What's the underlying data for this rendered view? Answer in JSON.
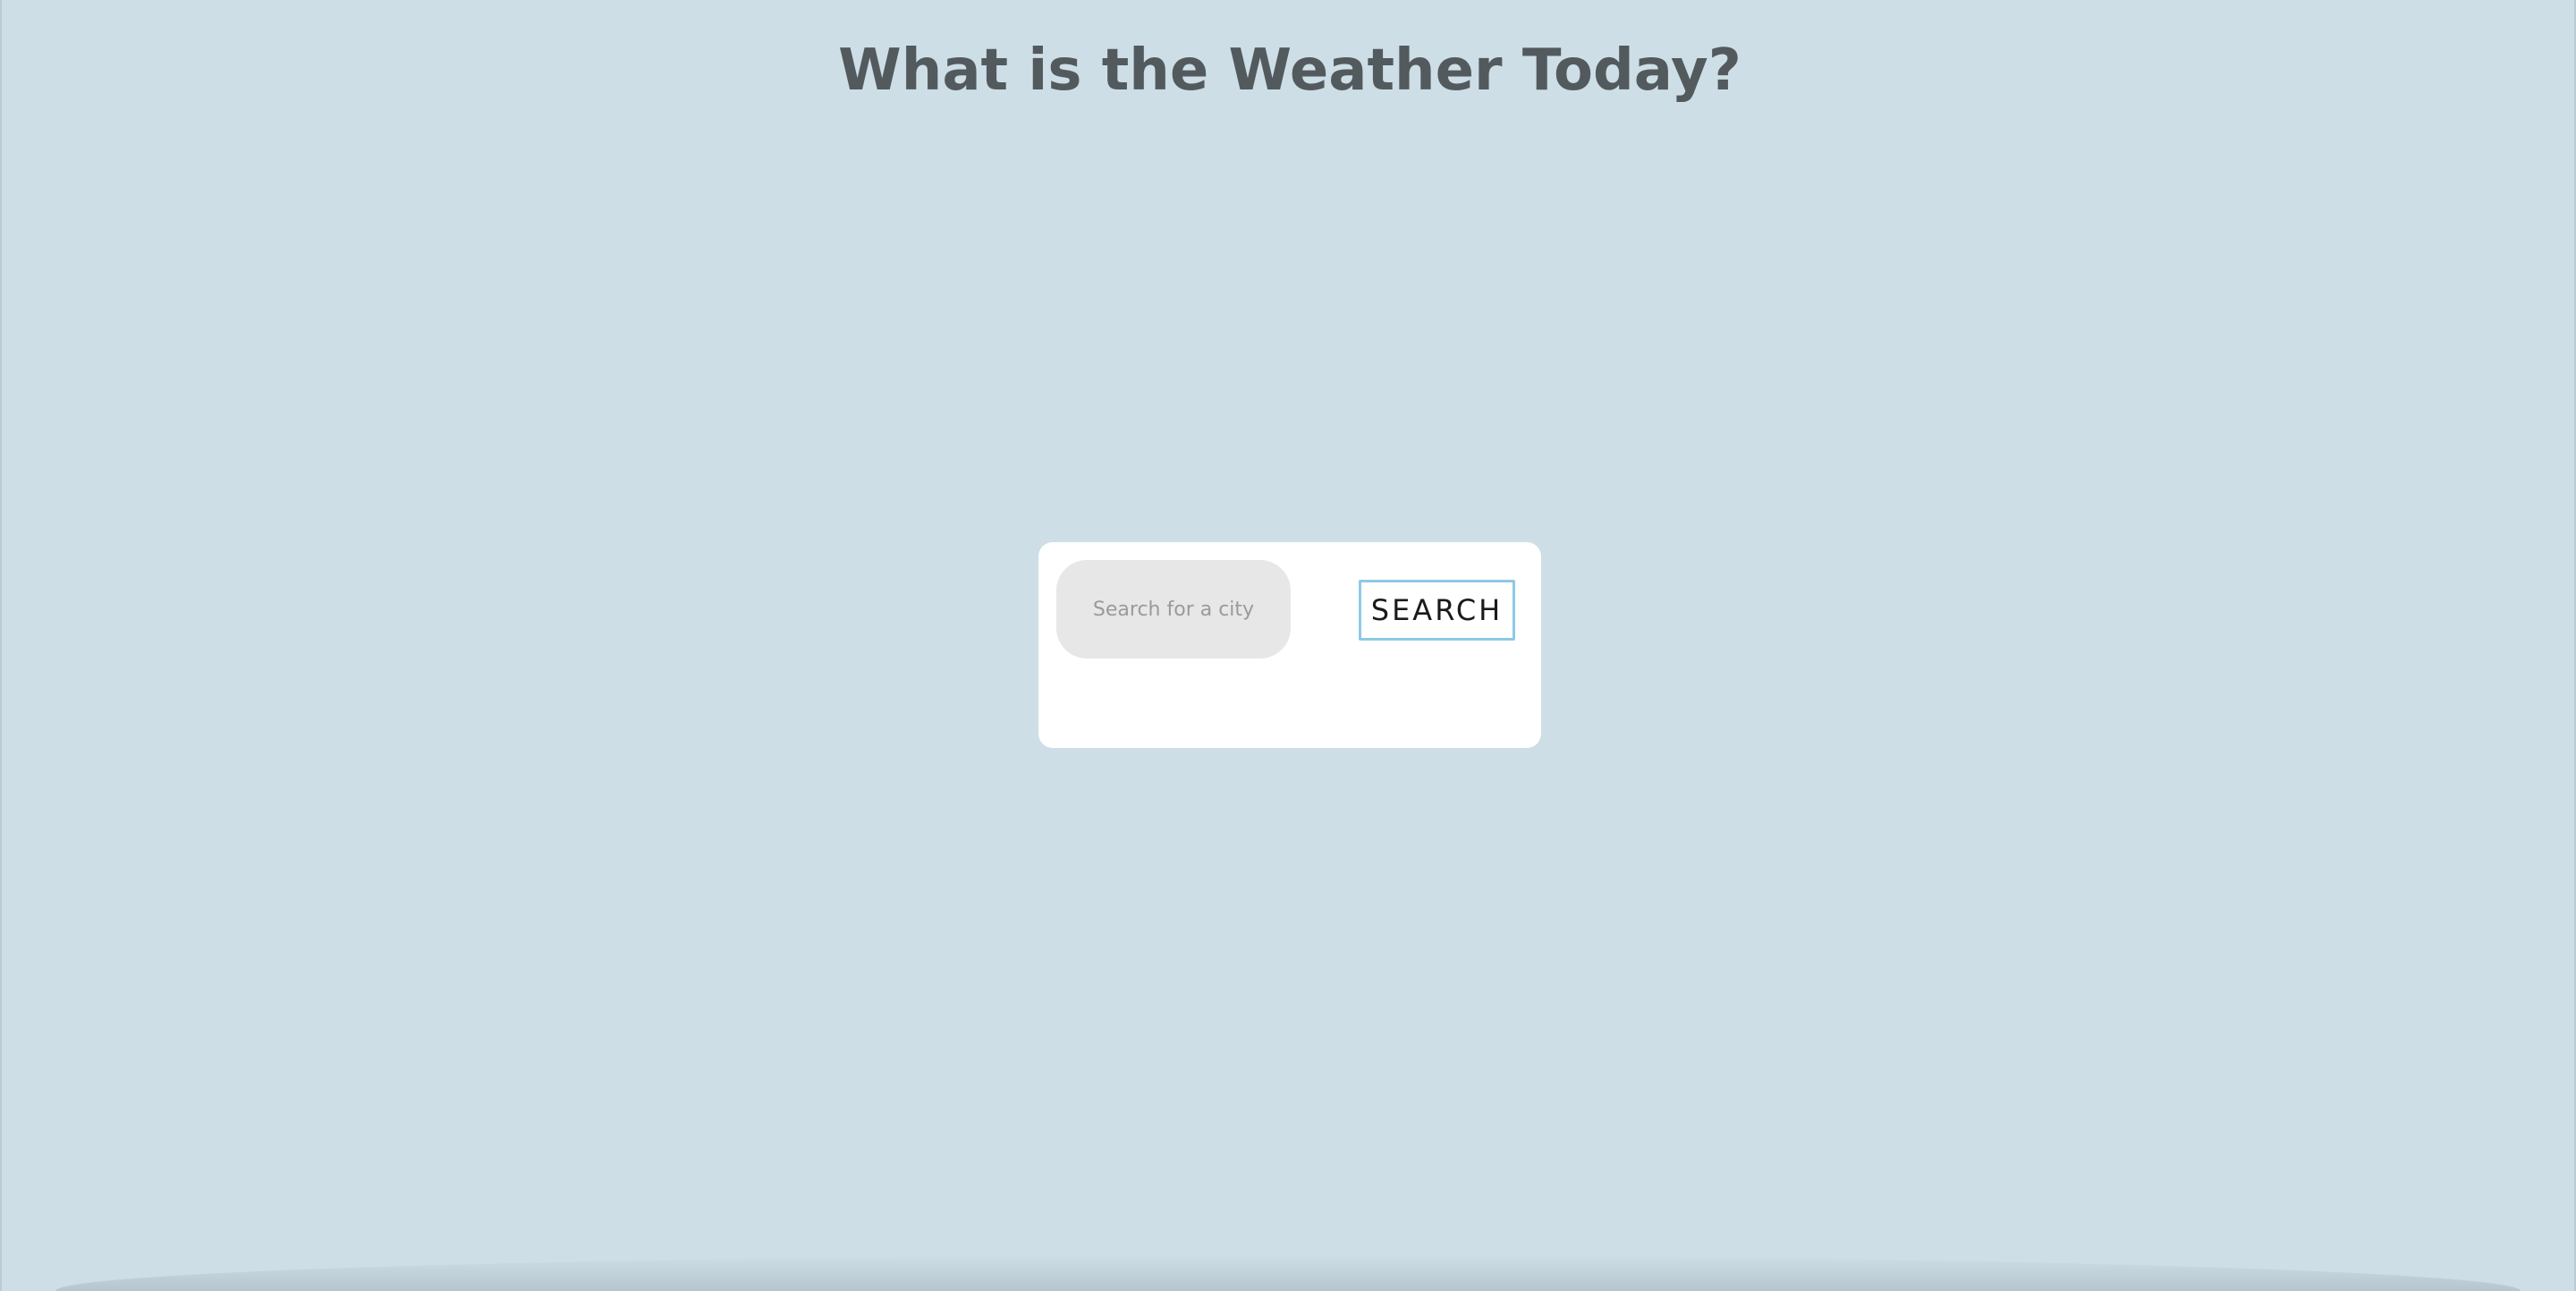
{
  "header": {
    "title": "What is the Weather Today?"
  },
  "search": {
    "placeholder": "Search for a city",
    "value": "",
    "button_label": "SEARCH"
  },
  "colors": {
    "background": "#cddee6",
    "title_text": "#525a5e",
    "card": "#ffffff",
    "input_background": "#e7e7e7",
    "button_border": "#8ec9e6"
  }
}
